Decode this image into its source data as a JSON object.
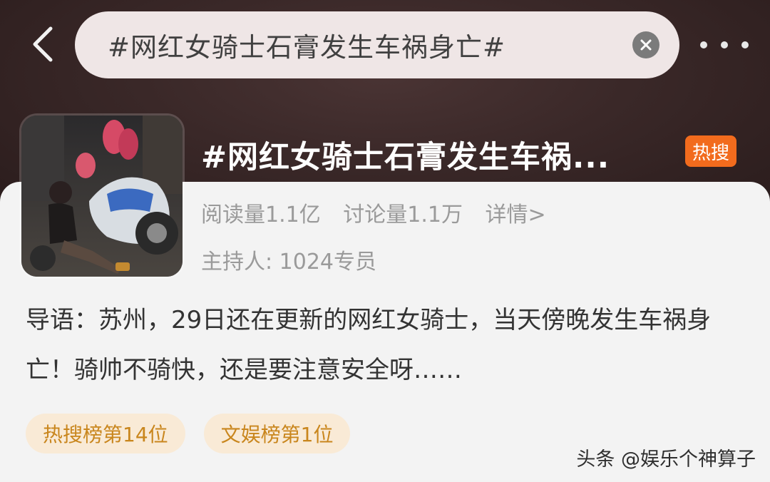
{
  "search": {
    "query": "#网红女骑士石膏发生车祸身亡#"
  },
  "topic": {
    "title": "#网红女骑士石膏发生车祸...",
    "badge": "热搜",
    "reads": "阅读量1.1亿",
    "discussions": "讨论量1.1万",
    "details_link": "详情>",
    "host": "主持人: 1024专员",
    "intro": "导语：苏州，29日还在更新的网红女骑士，当天傍晚发生车祸身亡！骑帅不骑快，还是要注意安全呀……"
  },
  "tags": [
    {
      "label": "热搜榜第14位"
    },
    {
      "label": "文娱榜第1位"
    }
  ],
  "watermark": "头条 @娱乐个神算子",
  "colors": {
    "header_bg": "#3a2828",
    "card_bg": "#f3f3f3",
    "badge_orange": "#f26b1d",
    "tag_bg": "#f9ead6",
    "tag_text": "#c9861d"
  }
}
